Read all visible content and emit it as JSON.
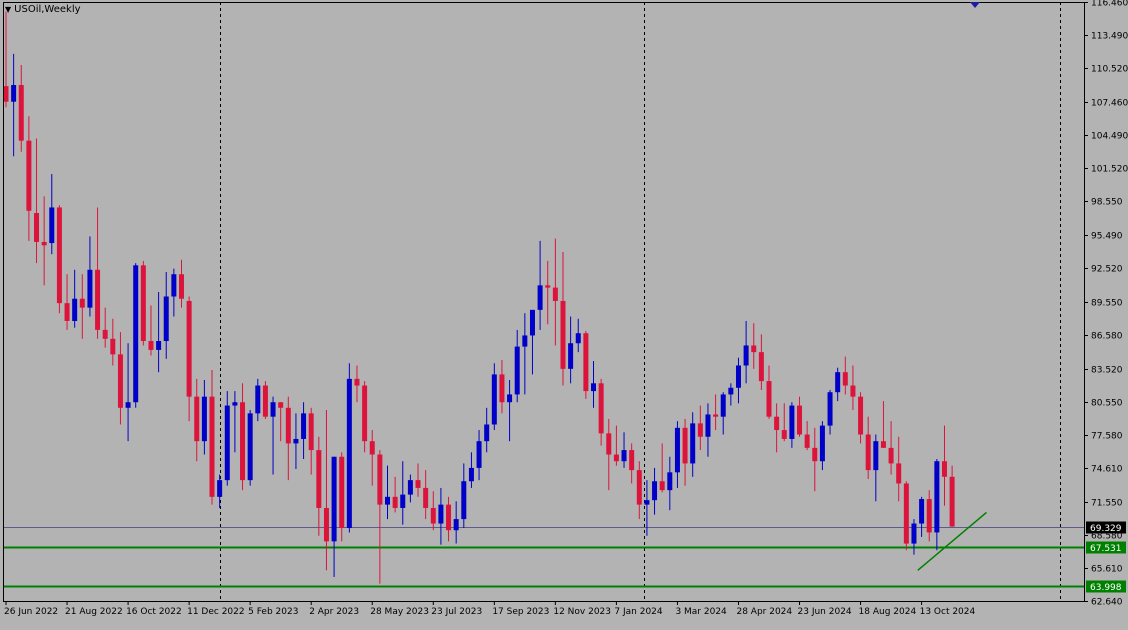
{
  "symbol_label": "USOil,Weekly",
  "colors": {
    "background": "#b3b3b3",
    "bull": "#0000c8",
    "bear": "#dc143c",
    "support": "#008000",
    "current_price_line": "#5c5c8a"
  },
  "chart_data": {
    "type": "candlestick",
    "title": "USOil,Weekly",
    "ylim": [
      62.64,
      116.46
    ],
    "y_ticks": [
      "116.460",
      "113.490",
      "110.520",
      "107.460",
      "104.490",
      "101.520",
      "98.550",
      "95.490",
      "92.520",
      "89.550",
      "86.580",
      "83.520",
      "80.550",
      "77.580",
      "74.610",
      "71.550",
      "68.580",
      "65.610",
      "62.640"
    ],
    "x_ticks": [
      "26 Jun 2022",
      "21 Aug 2022",
      "16 Oct 2022",
      "11 Dec 2022",
      "5 Feb 2023",
      "2 Apr 2023",
      "28 May 2023",
      "23 Jul 2023",
      "17 Sep 2023",
      "12 Nov 2023",
      "7 Jan 2024",
      "3 Mar 2024",
      "28 Apr 2024",
      "23 Jun 2024",
      "18 Aug 2024",
      "13 Oct 2024"
    ],
    "grid": "vertical-dashed",
    "horizontal_levels": [
      {
        "label": "69.329",
        "value": 69.329,
        "kind": "current"
      },
      {
        "label": "67.531",
        "value": 67.531,
        "kind": "support"
      },
      {
        "label": "63.998",
        "value": 63.998,
        "kind": "support"
      }
    ],
    "trendline": {
      "from": [
        119.5,
        65.4
      ],
      "to": [
        128.5,
        70.6
      ]
    },
    "candles": [
      {
        "i": 0,
        "o": 108.9,
        "h": 115.6,
        "l": 107.0,
        "c": 107.5
      },
      {
        "i": 1,
        "o": 107.5,
        "h": 111.8,
        "l": 102.6,
        "c": 109.0
      },
      {
        "i": 2,
        "o": 109.0,
        "h": 110.8,
        "l": 103.0,
        "c": 104.0
      },
      {
        "i": 3,
        "o": 104.0,
        "h": 106.2,
        "l": 95.0,
        "c": 97.7
      },
      {
        "i": 4,
        "o": 97.5,
        "h": 104.2,
        "l": 93.0,
        "c": 94.9
      },
      {
        "i": 5,
        "o": 94.9,
        "h": 99.0,
        "l": 91.0,
        "c": 94.6
      },
      {
        "i": 6,
        "o": 94.8,
        "h": 101.0,
        "l": 93.8,
        "c": 98.0
      },
      {
        "i": 7,
        "o": 98.0,
        "h": 98.2,
        "l": 88.5,
        "c": 89.4
      },
      {
        "i": 8,
        "o": 89.4,
        "h": 92.0,
        "l": 87.0,
        "c": 87.8
      },
      {
        "i": 9,
        "o": 87.8,
        "h": 92.4,
        "l": 87.2,
        "c": 89.8
      },
      {
        "i": 10,
        "o": 89.8,
        "h": 92.0,
        "l": 86.2,
        "c": 89.0
      },
      {
        "i": 11,
        "o": 89.0,
        "h": 95.4,
        "l": 88.2,
        "c": 92.4
      },
      {
        "i": 12,
        "o": 92.4,
        "h": 98.0,
        "l": 86.2,
        "c": 87.0
      },
      {
        "i": 13,
        "o": 87.0,
        "h": 89.0,
        "l": 85.4,
        "c": 86.2
      },
      {
        "i": 14,
        "o": 86.2,
        "h": 88.0,
        "l": 83.8,
        "c": 84.8
      },
      {
        "i": 15,
        "o": 84.8,
        "h": 86.8,
        "l": 78.5,
        "c": 80.0
      },
      {
        "i": 16,
        "o": 80.0,
        "h": 85.8,
        "l": 77.0,
        "c": 80.5
      },
      {
        "i": 17,
        "o": 80.5,
        "h": 93.0,
        "l": 80.0,
        "c": 92.8
      },
      {
        "i": 18,
        "o": 92.8,
        "h": 93.2,
        "l": 85.6,
        "c": 86.0
      },
      {
        "i": 19,
        "o": 86.0,
        "h": 89.2,
        "l": 84.7,
        "c": 85.2
      },
      {
        "i": 20,
        "o": 85.2,
        "h": 90.4,
        "l": 83.2,
        "c": 86.0
      },
      {
        "i": 21,
        "o": 86.0,
        "h": 92.2,
        "l": 84.4,
        "c": 90.0
      },
      {
        "i": 22,
        "o": 90.0,
        "h": 92.5,
        "l": 88.2,
        "c": 92.0
      },
      {
        "i": 23,
        "o": 92.0,
        "h": 93.3,
        "l": 89.0,
        "c": 89.8
      },
      {
        "i": 24,
        "o": 89.6,
        "h": 90.0,
        "l": 78.8,
        "c": 81.0
      },
      {
        "i": 25,
        "o": 81.0,
        "h": 82.6,
        "l": 75.2,
        "c": 77.0
      },
      {
        "i": 26,
        "o": 77.0,
        "h": 82.5,
        "l": 75.8,
        "c": 81.0
      },
      {
        "i": 27,
        "o": 81.0,
        "h": 83.4,
        "l": 71.3,
        "c": 72.0
      },
      {
        "i": 28,
        "o": 72.0,
        "h": 74.0,
        "l": 71.0,
        "c": 73.5
      },
      {
        "i": 29,
        "o": 73.5,
        "h": 81.5,
        "l": 73.0,
        "c": 80.2
      },
      {
        "i": 30,
        "o": 80.2,
        "h": 81.5,
        "l": 76.0,
        "c": 80.5
      },
      {
        "i": 31,
        "o": 80.5,
        "h": 82.2,
        "l": 72.6,
        "c": 73.5
      },
      {
        "i": 32,
        "o": 73.5,
        "h": 79.8,
        "l": 73.0,
        "c": 79.5
      },
      {
        "i": 33,
        "o": 79.5,
        "h": 82.6,
        "l": 78.8,
        "c": 82.0
      },
      {
        "i": 34,
        "o": 82.0,
        "h": 82.4,
        "l": 79.0,
        "c": 79.2
      },
      {
        "i": 35,
        "o": 79.2,
        "h": 81.0,
        "l": 74.0,
        "c": 80.5
      },
      {
        "i": 36,
        "o": 80.5,
        "h": 80.5,
        "l": 77.0,
        "c": 80.0
      },
      {
        "i": 37,
        "o": 80.0,
        "h": 81.0,
        "l": 73.5,
        "c": 76.8
      },
      {
        "i": 38,
        "o": 76.8,
        "h": 79.5,
        "l": 74.5,
        "c": 77.2
      },
      {
        "i": 39,
        "o": 77.2,
        "h": 80.5,
        "l": 75.4,
        "c": 79.5
      },
      {
        "i": 40,
        "o": 79.5,
        "h": 80.0,
        "l": 74.0,
        "c": 76.2
      },
      {
        "i": 41,
        "o": 76.2,
        "h": 77.4,
        "l": 68.5,
        "c": 71.0
      },
      {
        "i": 42,
        "o": 71.0,
        "h": 79.8,
        "l": 65.4,
        "c": 68.0
      },
      {
        "i": 43,
        "o": 68.0,
        "h": 75.6,
        "l": 64.8,
        "c": 75.6
      },
      {
        "i": 44,
        "o": 75.6,
        "h": 76.0,
        "l": 68.0,
        "c": 69.2
      },
      {
        "i": 45,
        "o": 69.2,
        "h": 84.0,
        "l": 68.8,
        "c": 82.6
      },
      {
        "i": 46,
        "o": 82.6,
        "h": 83.8,
        "l": 80.5,
        "c": 82.0
      },
      {
        "i": 47,
        "o": 82.0,
        "h": 82.4,
        "l": 76.0,
        "c": 77.0
      },
      {
        "i": 48,
        "o": 77.0,
        "h": 78.0,
        "l": 73.0,
        "c": 75.8
      },
      {
        "i": 49,
        "o": 75.8,
        "h": 76.2,
        "l": 64.2,
        "c": 71.3
      },
      {
        "i": 50,
        "o": 71.3,
        "h": 74.8,
        "l": 70.0,
        "c": 72.0
      },
      {
        "i": 51,
        "o": 72.0,
        "h": 73.8,
        "l": 70.6,
        "c": 71.0
      },
      {
        "i": 52,
        "o": 71.0,
        "h": 75.2,
        "l": 69.5,
        "c": 72.2
      },
      {
        "i": 53,
        "o": 72.2,
        "h": 74.0,
        "l": 71.5,
        "c": 73.5
      },
      {
        "i": 54,
        "o": 73.5,
        "h": 75.0,
        "l": 72.0,
        "c": 72.8
      },
      {
        "i": 55,
        "o": 72.8,
        "h": 74.4,
        "l": 70.0,
        "c": 71.0
      },
      {
        "i": 56,
        "o": 71.0,
        "h": 72.5,
        "l": 69.0,
        "c": 69.6
      },
      {
        "i": 57,
        "o": 69.6,
        "h": 72.8,
        "l": 67.7,
        "c": 71.3
      },
      {
        "i": 58,
        "o": 71.3,
        "h": 72.0,
        "l": 68.0,
        "c": 69.0
      },
      {
        "i": 59,
        "o": 69.0,
        "h": 71.6,
        "l": 67.8,
        "c": 70.0
      },
      {
        "i": 60,
        "o": 70.0,
        "h": 75.0,
        "l": 69.2,
        "c": 73.4
      },
      {
        "i": 61,
        "o": 73.4,
        "h": 76.0,
        "l": 72.8,
        "c": 74.6
      },
      {
        "i": 62,
        "o": 74.6,
        "h": 78.0,
        "l": 73.5,
        "c": 77.0
      },
      {
        "i": 63,
        "o": 77.0,
        "h": 80.0,
        "l": 76.0,
        "c": 78.5
      },
      {
        "i": 64,
        "o": 78.5,
        "h": 84.0,
        "l": 78.0,
        "c": 83.0
      },
      {
        "i": 65,
        "o": 83.0,
        "h": 84.3,
        "l": 79.5,
        "c": 80.5
      },
      {
        "i": 66,
        "o": 80.5,
        "h": 82.5,
        "l": 77.0,
        "c": 81.2
      },
      {
        "i": 67,
        "o": 81.2,
        "h": 87.0,
        "l": 80.5,
        "c": 85.5
      },
      {
        "i": 68,
        "o": 85.5,
        "h": 88.5,
        "l": 81.2,
        "c": 86.5
      },
      {
        "i": 69,
        "o": 86.5,
        "h": 87.0,
        "l": 83.0,
        "c": 88.8
      },
      {
        "i": 70,
        "o": 88.8,
        "h": 95.0,
        "l": 87.0,
        "c": 91.0
      },
      {
        "i": 71,
        "o": 91.0,
        "h": 93.2,
        "l": 87.5,
        "c": 90.8
      },
      {
        "i": 72,
        "o": 90.8,
        "h": 95.2,
        "l": 85.6,
        "c": 89.6
      },
      {
        "i": 73,
        "o": 89.6,
        "h": 94.0,
        "l": 82.0,
        "c": 83.5
      },
      {
        "i": 74,
        "o": 83.5,
        "h": 88.2,
        "l": 82.2,
        "c": 85.8
      },
      {
        "i": 75,
        "o": 85.8,
        "h": 88.0,
        "l": 85.0,
        "c": 86.7
      },
      {
        "i": 76,
        "o": 86.7,
        "h": 86.9,
        "l": 80.8,
        "c": 81.5
      },
      {
        "i": 77,
        "o": 81.5,
        "h": 84.2,
        "l": 80.0,
        "c": 82.2
      },
      {
        "i": 78,
        "o": 82.2,
        "h": 82.6,
        "l": 76.6,
        "c": 77.7
      },
      {
        "i": 79,
        "o": 77.7,
        "h": 79.0,
        "l": 72.6,
        "c": 75.8
      },
      {
        "i": 80,
        "o": 75.8,
        "h": 78.4,
        "l": 74.8,
        "c": 75.2
      },
      {
        "i": 81,
        "o": 75.2,
        "h": 77.8,
        "l": 74.6,
        "c": 76.2
      },
      {
        "i": 82,
        "o": 76.2,
        "h": 76.8,
        "l": 73.2,
        "c": 74.4
      },
      {
        "i": 83,
        "o": 74.4,
        "h": 75.2,
        "l": 70.0,
        "c": 71.3
      },
      {
        "i": 84,
        "o": 71.3,
        "h": 73.5,
        "l": 68.5,
        "c": 71.7
      },
      {
        "i": 85,
        "o": 71.7,
        "h": 74.6,
        "l": 70.4,
        "c": 73.4
      },
      {
        "i": 86,
        "o": 73.4,
        "h": 76.8,
        "l": 72.4,
        "c": 72.6
      },
      {
        "i": 87,
        "o": 72.6,
        "h": 75.6,
        "l": 70.8,
        "c": 74.2
      },
      {
        "i": 88,
        "o": 74.2,
        "h": 78.8,
        "l": 72.8,
        "c": 78.2
      },
      {
        "i": 89,
        "o": 78.2,
        "h": 79.0,
        "l": 73.0,
        "c": 75.0
      },
      {
        "i": 90,
        "o": 75.0,
        "h": 79.6,
        "l": 73.8,
        "c": 78.6
      },
      {
        "i": 91,
        "o": 78.6,
        "h": 80.2,
        "l": 76.2,
        "c": 77.4
      },
      {
        "i": 92,
        "o": 77.4,
        "h": 80.4,
        "l": 75.6,
        "c": 79.4
      },
      {
        "i": 93,
        "o": 79.4,
        "h": 81.2,
        "l": 78.0,
        "c": 79.2
      },
      {
        "i": 94,
        "o": 79.2,
        "h": 81.4,
        "l": 77.6,
        "c": 81.2
      },
      {
        "i": 95,
        "o": 81.2,
        "h": 82.2,
        "l": 80.2,
        "c": 81.8
      },
      {
        "i": 96,
        "o": 81.8,
        "h": 84.5,
        "l": 80.4,
        "c": 83.8
      },
      {
        "i": 97,
        "o": 83.8,
        "h": 87.8,
        "l": 82.2,
        "c": 85.6
      },
      {
        "i": 98,
        "o": 85.6,
        "h": 87.6,
        "l": 83.5,
        "c": 85.0
      },
      {
        "i": 99,
        "o": 85.0,
        "h": 86.6,
        "l": 81.6,
        "c": 82.4
      },
      {
        "i": 100,
        "o": 82.4,
        "h": 83.8,
        "l": 79.0,
        "c": 79.2
      },
      {
        "i": 101,
        "o": 79.2,
        "h": 80.4,
        "l": 76.0,
        "c": 78.0
      },
      {
        "i": 102,
        "o": 78.0,
        "h": 80.4,
        "l": 77.0,
        "c": 77.2
      },
      {
        "i": 103,
        "o": 77.2,
        "h": 80.5,
        "l": 76.4,
        "c": 80.2
      },
      {
        "i": 104,
        "o": 80.2,
        "h": 81.0,
        "l": 77.4,
        "c": 77.6
      },
      {
        "i": 105,
        "o": 77.6,
        "h": 78.8,
        "l": 76.2,
        "c": 76.4
      },
      {
        "i": 106,
        "o": 76.4,
        "h": 78.2,
        "l": 72.5,
        "c": 75.2
      },
      {
        "i": 107,
        "o": 75.2,
        "h": 78.8,
        "l": 74.4,
        "c": 78.4
      },
      {
        "i": 108,
        "o": 78.4,
        "h": 81.6,
        "l": 77.6,
        "c": 81.4
      },
      {
        "i": 109,
        "o": 81.4,
        "h": 83.6,
        "l": 80.6,
        "c": 83.2
      },
      {
        "i": 110,
        "o": 83.2,
        "h": 84.6,
        "l": 81.2,
        "c": 82.0
      },
      {
        "i": 111,
        "o": 82.0,
        "h": 83.8,
        "l": 79.8,
        "c": 81.0
      },
      {
        "i": 112,
        "o": 81.0,
        "h": 81.4,
        "l": 76.8,
        "c": 77.6
      },
      {
        "i": 113,
        "o": 77.6,
        "h": 79.2,
        "l": 73.6,
        "c": 74.4
      },
      {
        "i": 114,
        "o": 74.4,
        "h": 77.6,
        "l": 71.6,
        "c": 77.0
      },
      {
        "i": 115,
        "o": 77.0,
        "h": 80.6,
        "l": 76.4,
        "c": 76.4
      },
      {
        "i": 116,
        "o": 76.4,
        "h": 78.8,
        "l": 74.0,
        "c": 75.0
      },
      {
        "i": 117,
        "o": 75.0,
        "h": 77.4,
        "l": 71.6,
        "c": 73.2
      },
      {
        "i": 118,
        "o": 73.2,
        "h": 73.4,
        "l": 67.2,
        "c": 67.8
      },
      {
        "i": 119,
        "o": 67.8,
        "h": 70.0,
        "l": 66.8,
        "c": 69.6
      },
      {
        "i": 120,
        "o": 69.6,
        "h": 72.0,
        "l": 68.4,
        "c": 71.8
      },
      {
        "i": 121,
        "o": 71.8,
        "h": 72.6,
        "l": 68.0,
        "c": 68.8
      },
      {
        "i": 122,
        "o": 68.8,
        "h": 75.4,
        "l": 67.2,
        "c": 75.2
      },
      {
        "i": 123,
        "o": 75.2,
        "h": 78.4,
        "l": 71.2,
        "c": 73.8
      },
      {
        "i": 124,
        "o": 73.8,
        "h": 74.8,
        "l": 69.3,
        "c": 69.329
      }
    ]
  }
}
